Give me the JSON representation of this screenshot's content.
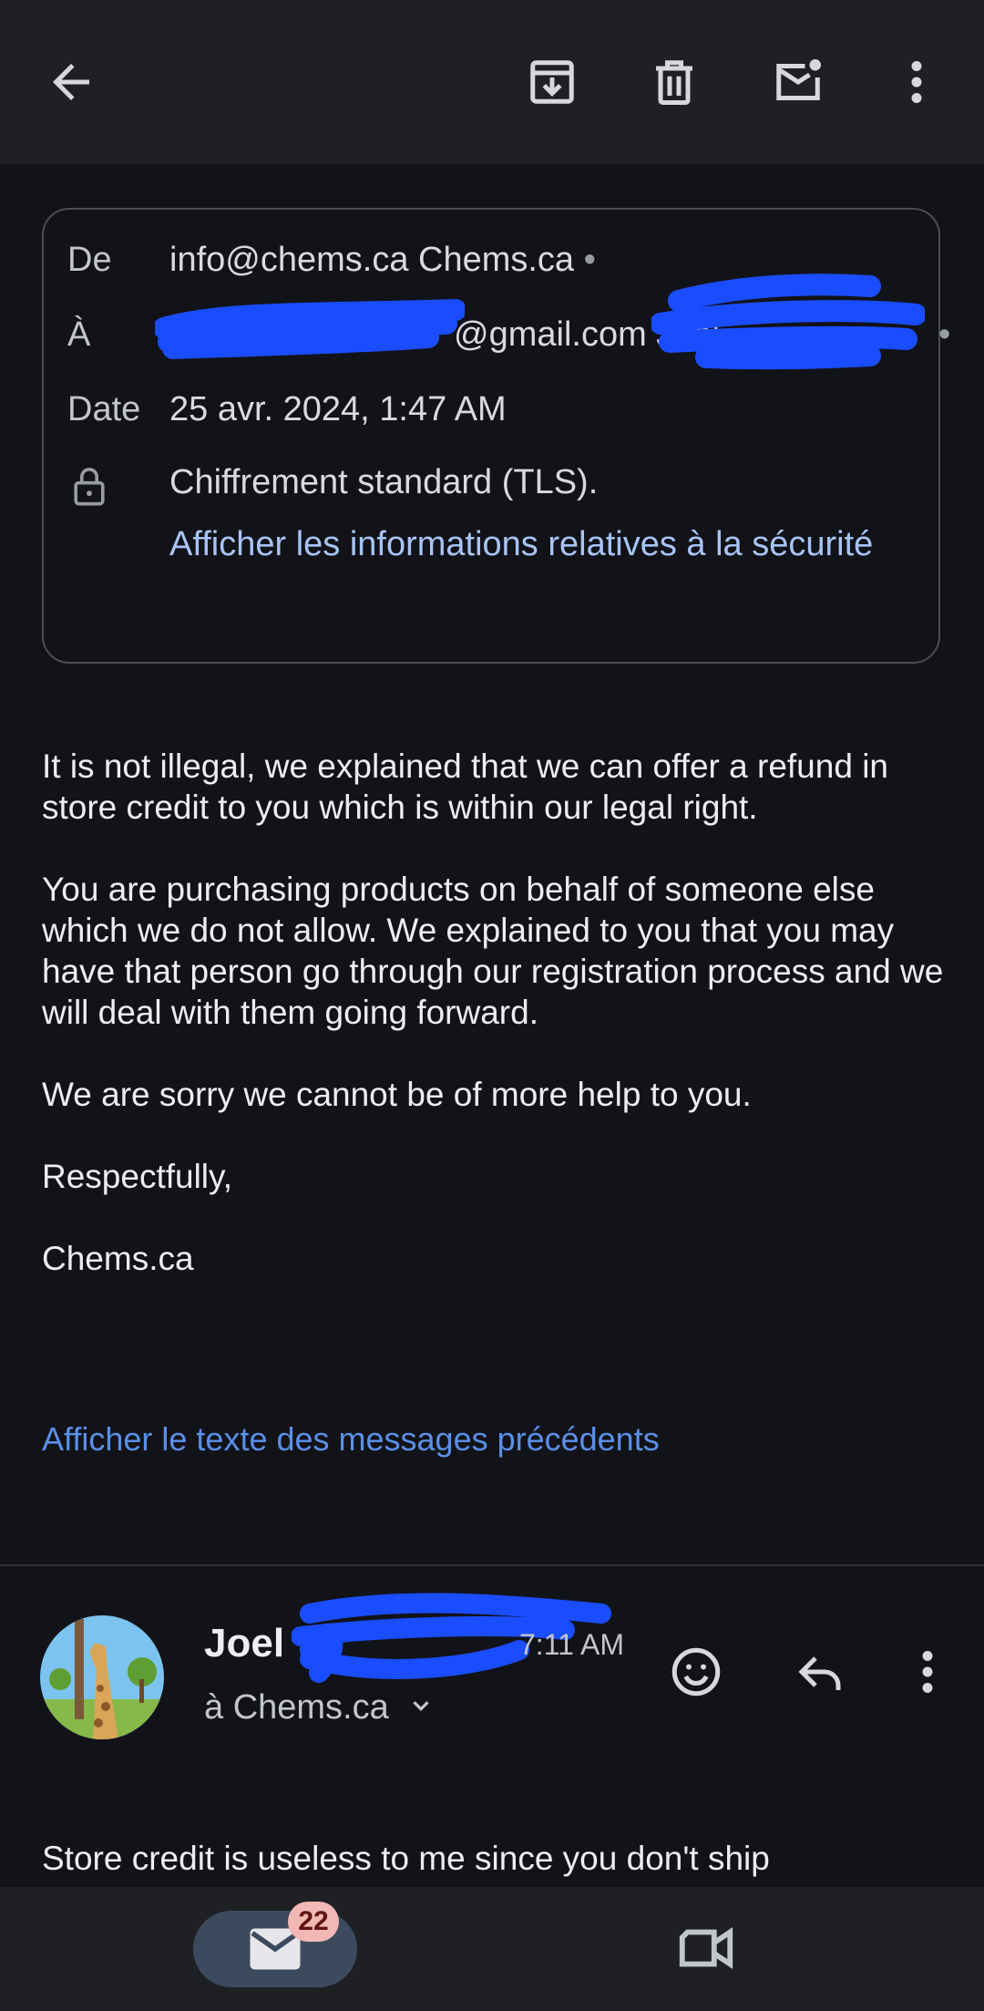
{
  "header": {
    "icons": [
      "back-arrow-icon",
      "archive-icon",
      "trash-icon",
      "mark-unread-icon",
      "more-vertical-icon"
    ]
  },
  "details": {
    "from_label": "De",
    "from_value": "info@chems.ca Chems.ca",
    "from_dot": "•",
    "to_label": "À",
    "to_visible": "@gmail.com Joel",
    "to_dot": "•",
    "date_label": "Date",
    "date_value": "25 avr. 2024, 1:47 AM",
    "security_text": "Chiffrement standard (TLS).",
    "security_link": "Afficher les informations relatives à la sécurité"
  },
  "message": {
    "paragraphs": [
      "It is not illegal, we explained that we can offer a refund in store credit to you which is within our legal right.",
      "You are purchasing products on behalf of someone else which we do not allow. We explained to you that you may have that person go through our registration process and we will deal with them going forward.",
      "We are sorry we cannot be of more help to you.",
      "Respectfully,",
      "Chems.ca"
    ],
    "show_previous": "Afficher le texte des messages précédents"
  },
  "reply": {
    "sender_name": "Joel",
    "time": "7:11 AM",
    "to": "à Chems.ca",
    "preview": "Store credit is useless to me since you don't ship"
  },
  "bottom_nav": {
    "mail_badge": "22"
  },
  "colors": {
    "background": "#121318",
    "toolbar": "#1f2024",
    "link": "#a8c4f5",
    "link_secondary": "#5b8fe8",
    "redaction": "#1a4dff",
    "badge": "#f2b8b5"
  }
}
